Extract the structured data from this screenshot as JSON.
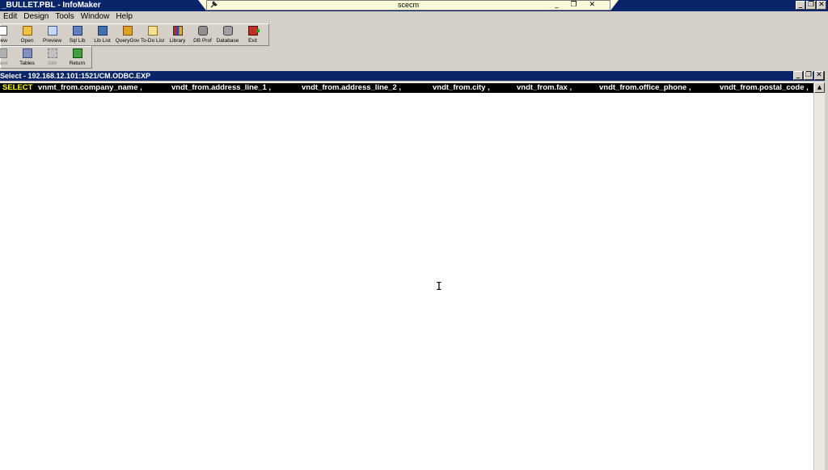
{
  "app": {
    "title": "_BULLET.PBL - InfoMaker",
    "window_buttons": {
      "minimize": "_",
      "restore": "❐",
      "close": "✕"
    }
  },
  "remote_session": {
    "pin_icon": "pin-icon",
    "host": "scecm",
    "controls": "_ ❐ ✕"
  },
  "menu": {
    "items": [
      "Edit",
      "Design",
      "Tools",
      "Window",
      "Help"
    ]
  },
  "toolbar1": {
    "buttons": [
      {
        "label": "New",
        "icon": "new-icon"
      },
      {
        "label": "Open",
        "icon": "open-folder-icon"
      },
      {
        "label": "Preview",
        "icon": "preview-icon"
      },
      {
        "label": "Sql Lib",
        "icon": "sql-library-icon"
      },
      {
        "label": "Lib List",
        "icon": "library-list-icon"
      },
      {
        "label": "QueryGov",
        "icon": "query-governor-icon"
      },
      {
        "label": "To-Do List",
        "icon": "todo-list-icon"
      },
      {
        "label": "Library",
        "icon": "library-books-icon"
      },
      {
        "label": "DB Prof",
        "icon": "db-profile-icon"
      },
      {
        "label": "Database",
        "icon": "database-icon"
      },
      {
        "label": "Exit",
        "icon": "exit-icon"
      }
    ]
  },
  "toolbar2": {
    "buttons": [
      {
        "label": "Save",
        "icon": "save-icon",
        "enabled": false
      },
      {
        "label": "Tables",
        "icon": "tables-icon",
        "enabled": true
      },
      {
        "label": "Join",
        "icon": "join-icon",
        "enabled": false
      },
      {
        "label": "Return",
        "icon": "return-icon",
        "enabled": true
      }
    ]
  },
  "child_window": {
    "title": "Select - 192.168.12.101:1521/CM.ODBC.EXP"
  },
  "sql": {
    "keyword": "SELECT",
    "columns": [
      "vnmt_from.company_name ,",
      "vndt_from.address_line_1 ,",
      "vndt_from.address_line_2 ,",
      "vndt_from.city ,",
      "vndt_from.fax ,",
      "vndt_from.office_phone ,",
      "vndt_from.postal_code ,"
    ],
    "keyword_color": "#ffff00",
    "bar_color": "#000000"
  },
  "scrollbar": {
    "up_arrow": "▲"
  }
}
